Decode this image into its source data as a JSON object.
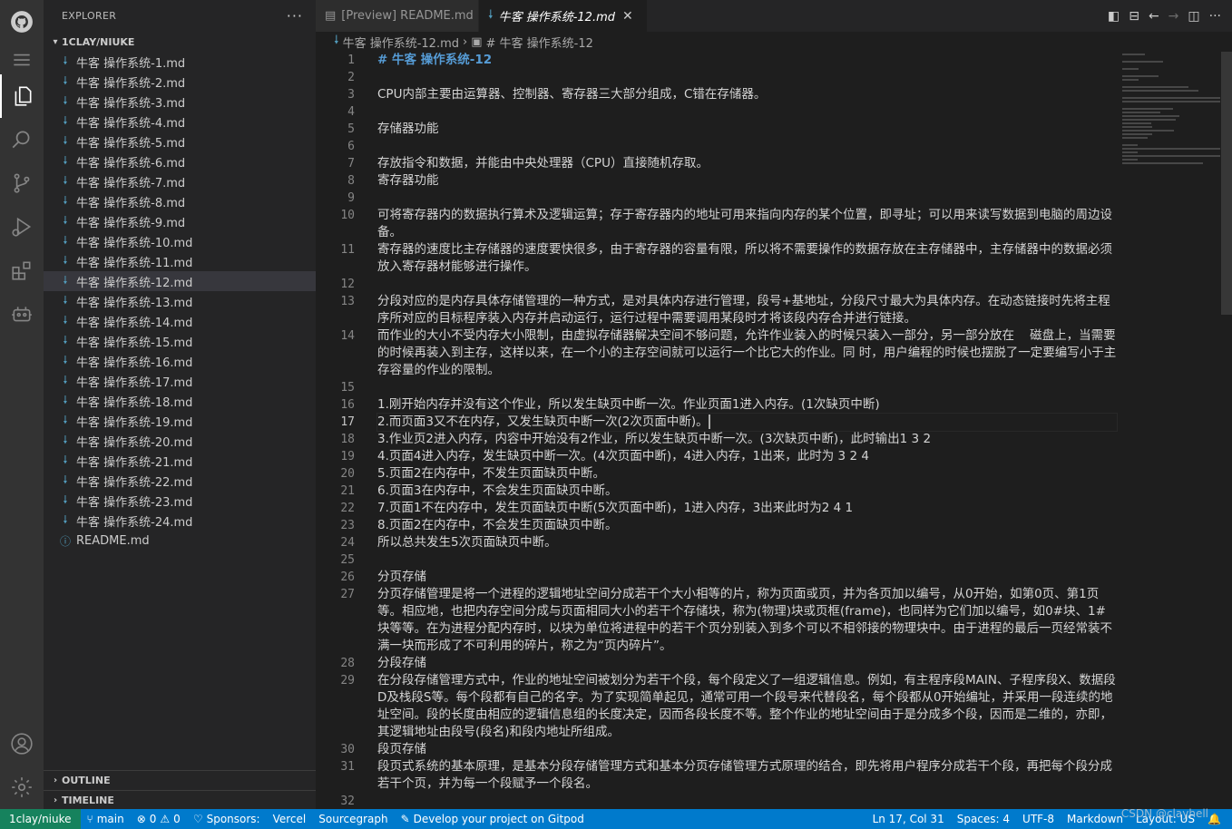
{
  "sidebar": {
    "title": "EXPLORER",
    "more": "···",
    "folder": "1CLAY/NIUKE",
    "files": [
      "牛客 操作系统-1.md",
      "牛客 操作系统-2.md",
      "牛客 操作系统-3.md",
      "牛客 操作系统-4.md",
      "牛客 操作系统-5.md",
      "牛客 操作系统-6.md",
      "牛客 操作系统-7.md",
      "牛客 操作系统-8.md",
      "牛客 操作系统-9.md",
      "牛客 操作系统-10.md",
      "牛客 操作系统-11.md",
      "牛客 操作系统-12.md",
      "牛客 操作系统-13.md",
      "牛客 操作系统-14.md",
      "牛客 操作系统-15.md",
      "牛客 操作系统-16.md",
      "牛客 操作系统-17.md",
      "牛客 操作系统-18.md",
      "牛客 操作系统-19.md",
      "牛客 操作系统-20.md",
      "牛客 操作系统-21.md",
      "牛客 操作系统-22.md",
      "牛客 操作系统-23.md",
      "牛客 操作系统-24.md"
    ],
    "readme": "README.md",
    "outline": "OUTLINE",
    "timeline": "TIMELINE"
  },
  "tabs": {
    "preview": "[Preview] README.md",
    "active": "牛客 操作系统-12.md"
  },
  "breadcrumb": {
    "file": "牛客 操作系统-12.md",
    "symbol": "# 牛客 操作系统-12"
  },
  "editor": {
    "lines": [
      {
        "n": "1",
        "text": "# 牛客 操作系统-12",
        "heading": true
      },
      {
        "n": "2",
        "text": ""
      },
      {
        "n": "3",
        "text": "CPU内部主要由运算器、控制器、寄存器三大部分组成，C错在存储器。"
      },
      {
        "n": "4",
        "text": ""
      },
      {
        "n": "5",
        "text": "存储器功能"
      },
      {
        "n": "6",
        "text": ""
      },
      {
        "n": "7",
        "text": "存放指令和数据，并能由中央处理器（CPU）直接随机存取。"
      },
      {
        "n": "8",
        "text": "寄存器功能"
      },
      {
        "n": "9",
        "text": ""
      },
      {
        "n": "10",
        "text": "可将寄存器内的数据执行算术及逻辑运算；存于寄存器内的地址可用来指向内存的某个位置，即寻址；可以用来读写数据到电脑的周边设备。"
      },
      {
        "n": "11",
        "text": "寄存器的速度比主存储器的速度要快很多，由于寄存器的容量有限，所以将不需要操作的数据存放在主存储器中，主存储器中的数据必须放入寄存器材能够进行操作。"
      },
      {
        "n": "12",
        "text": ""
      },
      {
        "n": "13",
        "text": "分段对应的是内存具体存储管理的一种方式，是对具体内存进行管理，段号+基地址，分段尺寸最大为具体内存。在动态链接时先将主程序所对应的目标程序装入内存并启动运行，运行过程中需要调用某段时才将该段内存合并进行链接。"
      },
      {
        "n": "14",
        "text": "而作业的大小不受内存大小限制，由虚拟存储器解决空间不够问题，允许作业装入的时候只装入一部分，另一部分放在    磁盘上，当需要的时候再装入到主存，这样以来，在一个小的主存空间就可以运行一个比它大的作业。同 时，用户编程的时候也摆脱了一定要编写小于主存容量的作业的限制。"
      },
      {
        "n": "15",
        "text": ""
      },
      {
        "n": "16",
        "text": "1.刚开始内存并没有这个作业，所以发生缺页中断一次。作业页面1进入内存。(1次缺页中断)"
      },
      {
        "n": "17",
        "text": "2.而页面3又不在内存，又发生缺页中断一次(2次页面中断)。",
        "current": true
      },
      {
        "n": "18",
        "text": "3.作业页2进入内存，内容中开始没有2作业，所以发生缺页中断一次。(3次缺页中断)，此时输出1 3 2"
      },
      {
        "n": "19",
        "text": "4.页面4进入内存，发生缺页中断一次。(4次页面中断)，4进入内存，1出来，此时为 3 2 4"
      },
      {
        "n": "20",
        "text": "5.页面2在内存中，不发生页面缺页中断。"
      },
      {
        "n": "21",
        "text": "6.页面3在内存中，不会发生页面缺页中断。"
      },
      {
        "n": "22",
        "text": "7.页面1不在内存中，发生页面缺页中断(5次页面中断)，1进入内存，3出来此时为2 4 1"
      },
      {
        "n": "23",
        "text": "8.页面2在内存中，不会发生页面缺页中断。"
      },
      {
        "n": "24",
        "text": "所以总共发生5次页面缺页中断。"
      },
      {
        "n": "25",
        "text": ""
      },
      {
        "n": "26",
        "text": "分页存储"
      },
      {
        "n": "27",
        "text": "分页存储管理是将一个进程的逻辑地址空间分成若干个大小相等的片，称为页面或页，并为各页加以编号，从0开始，如第0页、第1页等。相应地，也把内存空间分成与页面相同大小的若干个存储块，称为(物理)块或页框(frame)，也同样为它们加以编号，如0#块、1#块等等。在为进程分配内存时，以块为单位将进程中的若干个页分别装入到多个可以不相邻接的物理块中。由于进程的最后一页经常装不满一块而形成了不可利用的碎片，称之为“页内碎片”。"
      },
      {
        "n": "28",
        "text": "分段存储"
      },
      {
        "n": "29",
        "text": "在分段存储管理方式中，作业的地址空间被划分为若干个段，每个段定义了一组逻辑信息。例如，有主程序段MAIN、子程序段X、数据段D及栈段S等。每个段都有自己的名字。为了实现简单起见，通常可用一个段号来代替段名，每个段都从0开始编址，并采用一段连续的地址空间。段的长度由相应的逻辑信息组的长度决定，因而各段长度不等。整个作业的地址空间由于是分成多个段，因而是二维的，亦即，其逻辑地址由段号(段名)和段内地址所组成。"
      },
      {
        "n": "30",
        "text": "段页存储"
      },
      {
        "n": "31",
        "text": "段页式系统的基本原理，是基本分段存储管理方式和基本分页存储管理方式原理的结合，即先将用户程序分成若干个段，再把每个段分成若干个页，并为每一个段赋予一个段名。"
      },
      {
        "n": "32",
        "text": ""
      }
    ]
  },
  "statusbar": {
    "remote": "1clay/niuke",
    "branch": "main",
    "errors": "0",
    "warnings": "0",
    "sponsors": "Sponsors:",
    "vercel": "Vercel",
    "sourcegraph": "Sourcegraph",
    "gitpod": "Develop your project on Gitpod",
    "position": "Ln 17, Col 31",
    "spaces": "Spaces: 4",
    "encoding": "UTF-8",
    "language": "Markdown",
    "layout": "Layout: US"
  },
  "watermark": "CSDN @clayhell",
  "colors": {
    "accent": "#007acc",
    "remote": "#16825d",
    "heading": "#569cd6",
    "markdown_icon": "#519aba"
  }
}
